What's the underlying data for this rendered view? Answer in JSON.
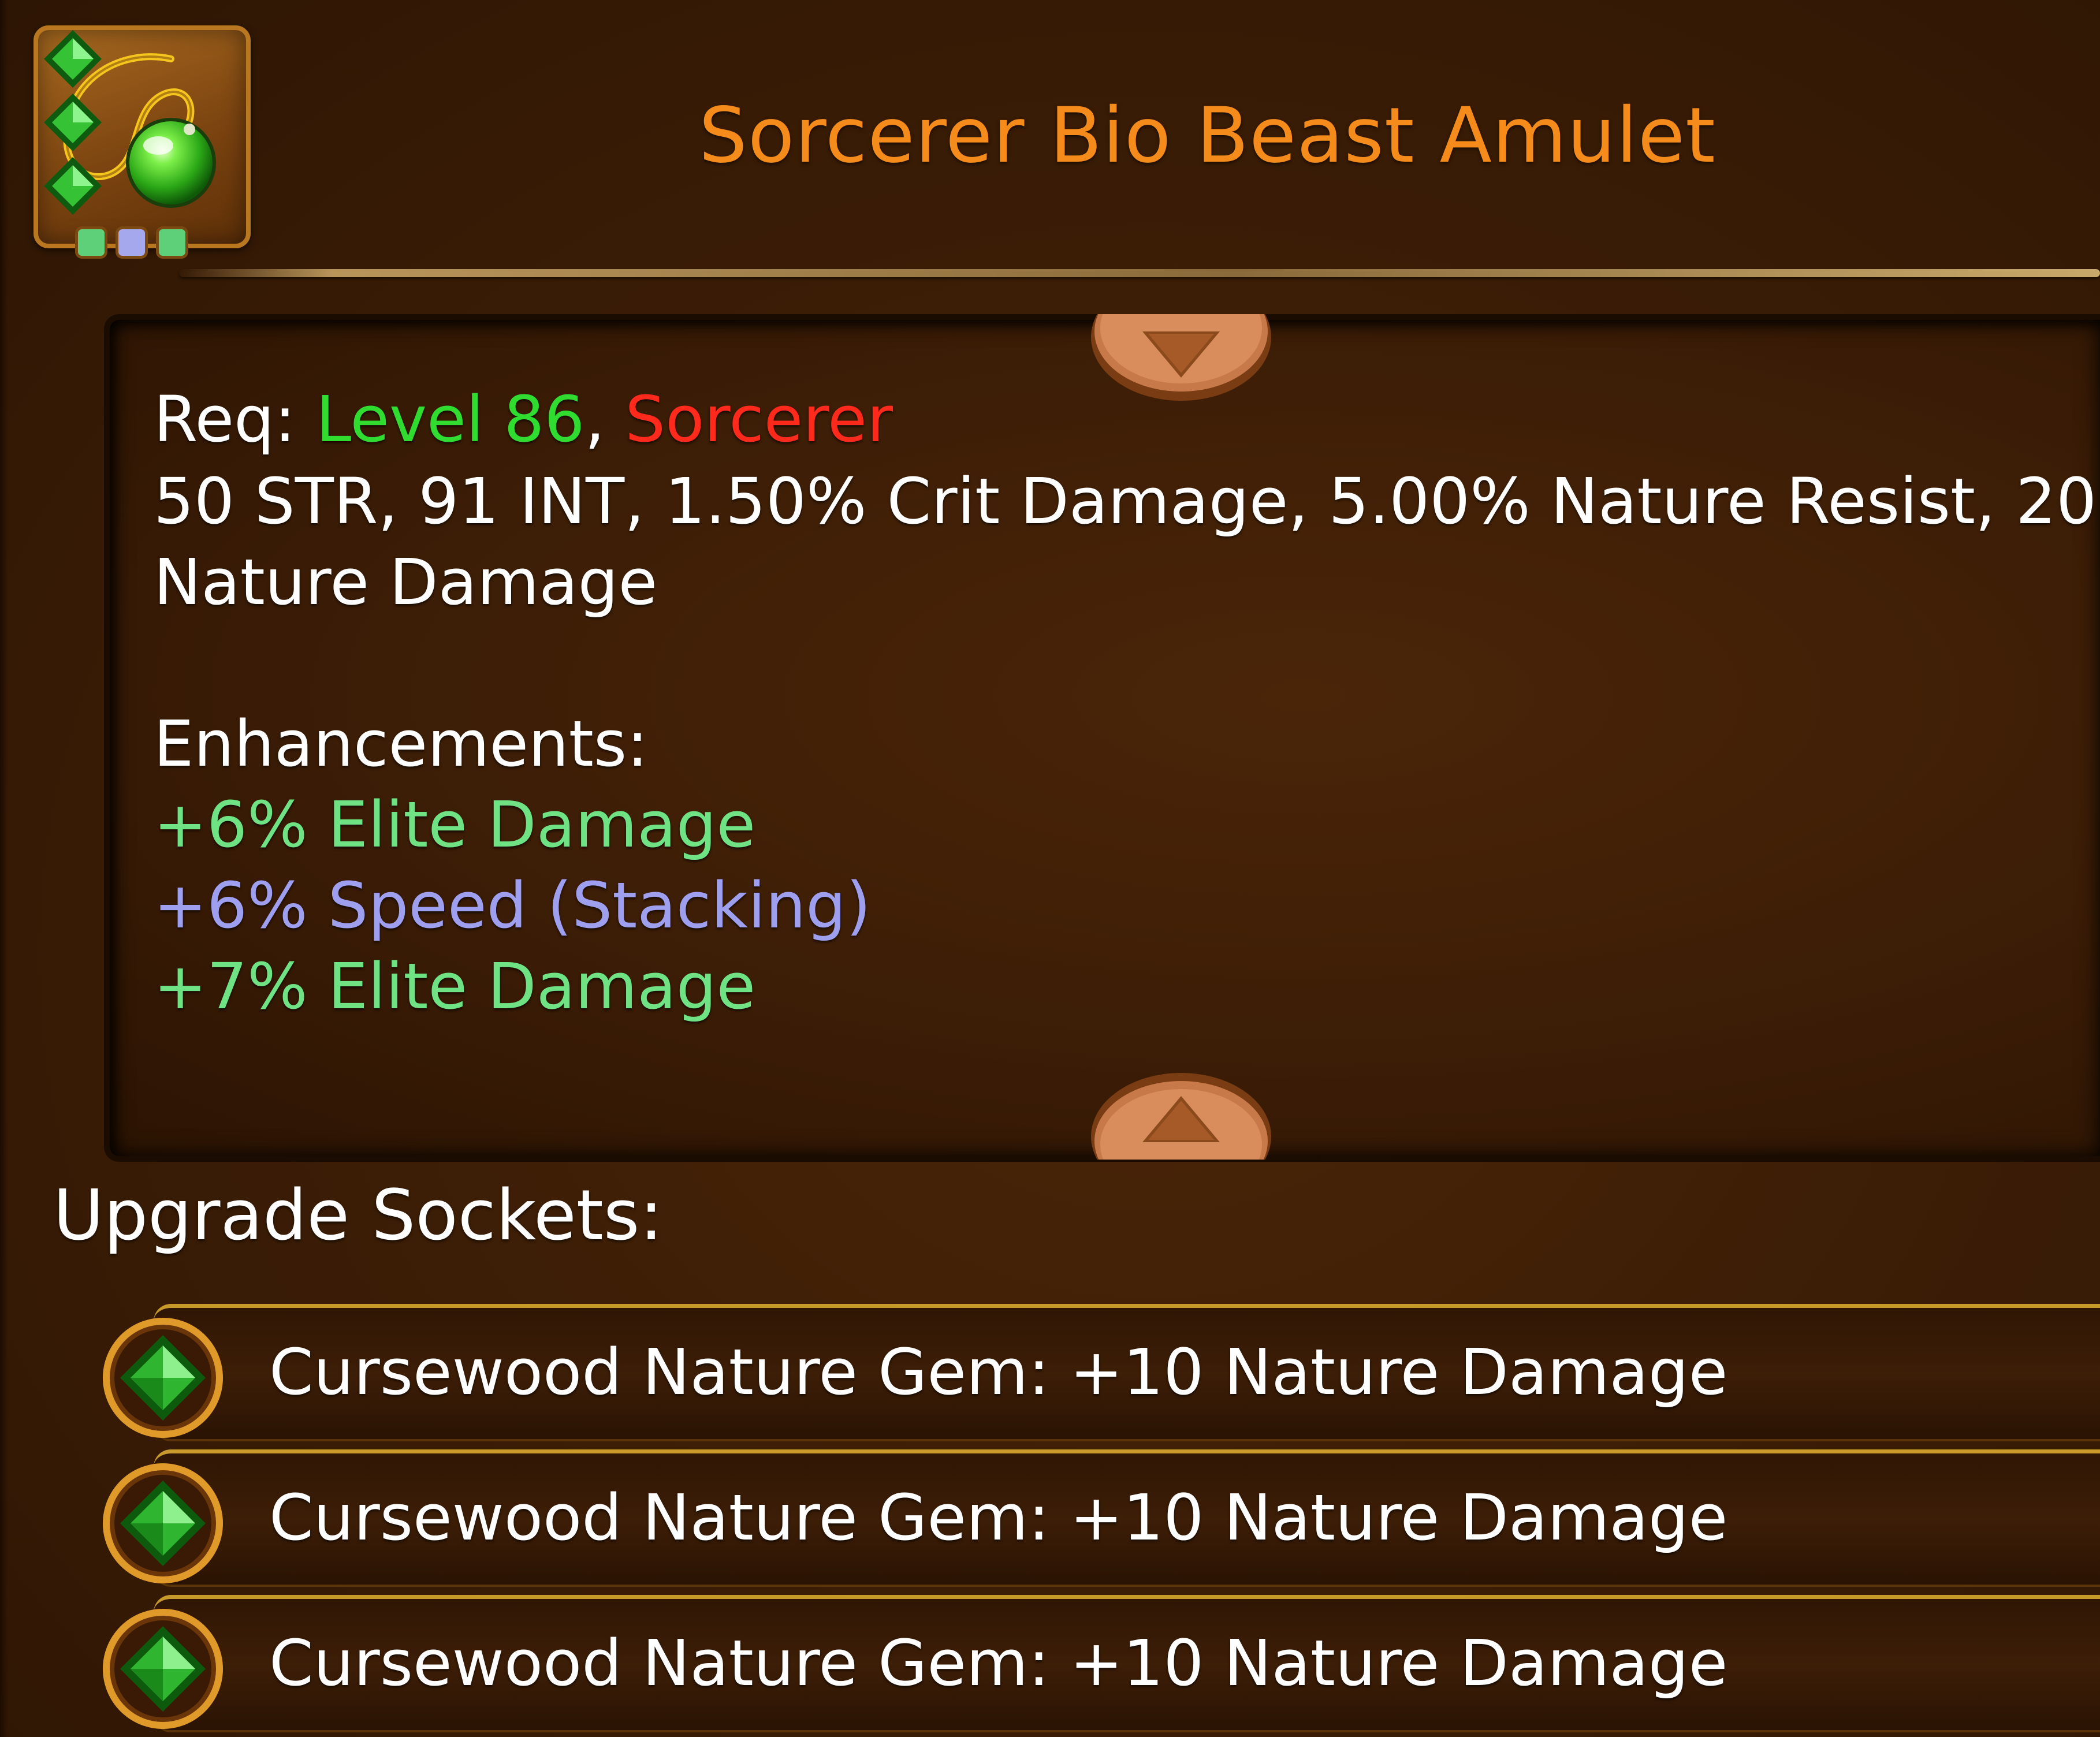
{
  "item": {
    "title": "Sorcerer Bio Beast Amulet",
    "title_color": "#f48b1a",
    "icon": "amulet-icon",
    "icon_dot_colors": [
      "#5fd07a",
      "#a6a8ee",
      "#5fd07a"
    ]
  },
  "requirements": {
    "label": "Req: ",
    "level": "Level 86",
    "separator": ", ",
    "class_name": "Sorcerer",
    "level_color": "#2fdc2f",
    "class_color": "#ff2a1c"
  },
  "stats": {
    "line1": "50 STR, 91 INT, 1.50% Crit Damage, 5.00% Nature Resist, 20",
    "line2": "Nature Damage"
  },
  "enhancements": {
    "heading": "Enhancements:",
    "items": [
      {
        "text": "+6% Elite Damage",
        "color": "#6fe383"
      },
      {
        "text": "+6% Speed (Stacking)",
        "color": "#9f9ff0"
      },
      {
        "text": "+7% Elite Damage",
        "color": "#6fe383"
      }
    ]
  },
  "sockets": {
    "heading": "Upgrade Sockets:",
    "items": [
      {
        "label": "Cursewood Nature Gem: +10 Nature Damage",
        "icon": "nature-gem-icon"
      },
      {
        "label": "Cursewood Nature Gem: +10 Nature Damage",
        "icon": "nature-gem-icon"
      },
      {
        "label": "Cursewood Nature Gem: +10 Nature Damage",
        "icon": "nature-gem-icon"
      }
    ]
  },
  "controls": {
    "scroll_up_icon": "scroll-up-arrow-icon",
    "scroll_down_icon": "scroll-down-arrow-icon"
  }
}
